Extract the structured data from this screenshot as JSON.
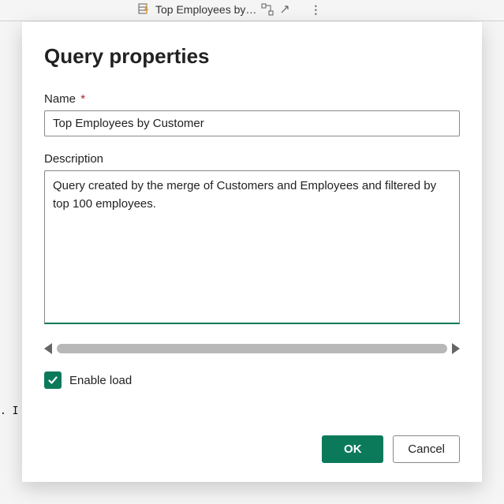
{
  "background": {
    "tab_label": "Top Employees by…",
    "code_fragment": ". I"
  },
  "dialog": {
    "title": "Query properties",
    "name_label": "Name",
    "name_required_marker": "*",
    "name_value": "Top Employees by Customer",
    "description_label": "Description",
    "description_value": "Query created by the merge of Customers and Employees and filtered by top 100 employees.",
    "enable_load_label": "Enable load",
    "enable_load_checked": true,
    "ok_label": "OK",
    "cancel_label": "Cancel"
  }
}
